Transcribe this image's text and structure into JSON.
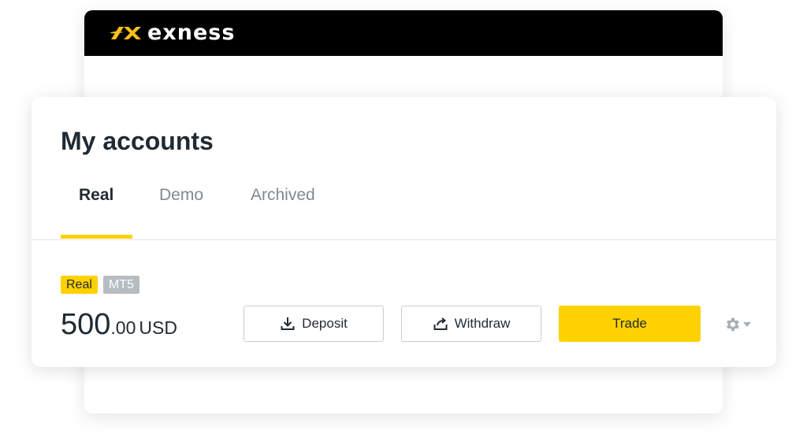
{
  "brand": {
    "name": "exness",
    "logo_color": "#f7c01b"
  },
  "page": {
    "title": "My accounts"
  },
  "tabs": [
    {
      "label": "Real",
      "active": true
    },
    {
      "label": "Demo",
      "active": false
    },
    {
      "label": "Archived",
      "active": false
    }
  ],
  "account": {
    "badges": {
      "type": "Real",
      "platform": "MT5"
    },
    "balance": {
      "whole": "500",
      "fraction": ".00",
      "currency": "USD"
    }
  },
  "actions": {
    "deposit": {
      "label": "Deposit",
      "icon": "download-icon"
    },
    "withdraw": {
      "label": "Withdraw",
      "icon": "upload-icon"
    },
    "trade": {
      "label": "Trade"
    },
    "settings": {
      "icon": "gear-icon"
    }
  },
  "colors": {
    "accent": "#ffd100",
    "topbar": "#000000",
    "text": "#1f2a33",
    "muted": "#7e8a91"
  }
}
